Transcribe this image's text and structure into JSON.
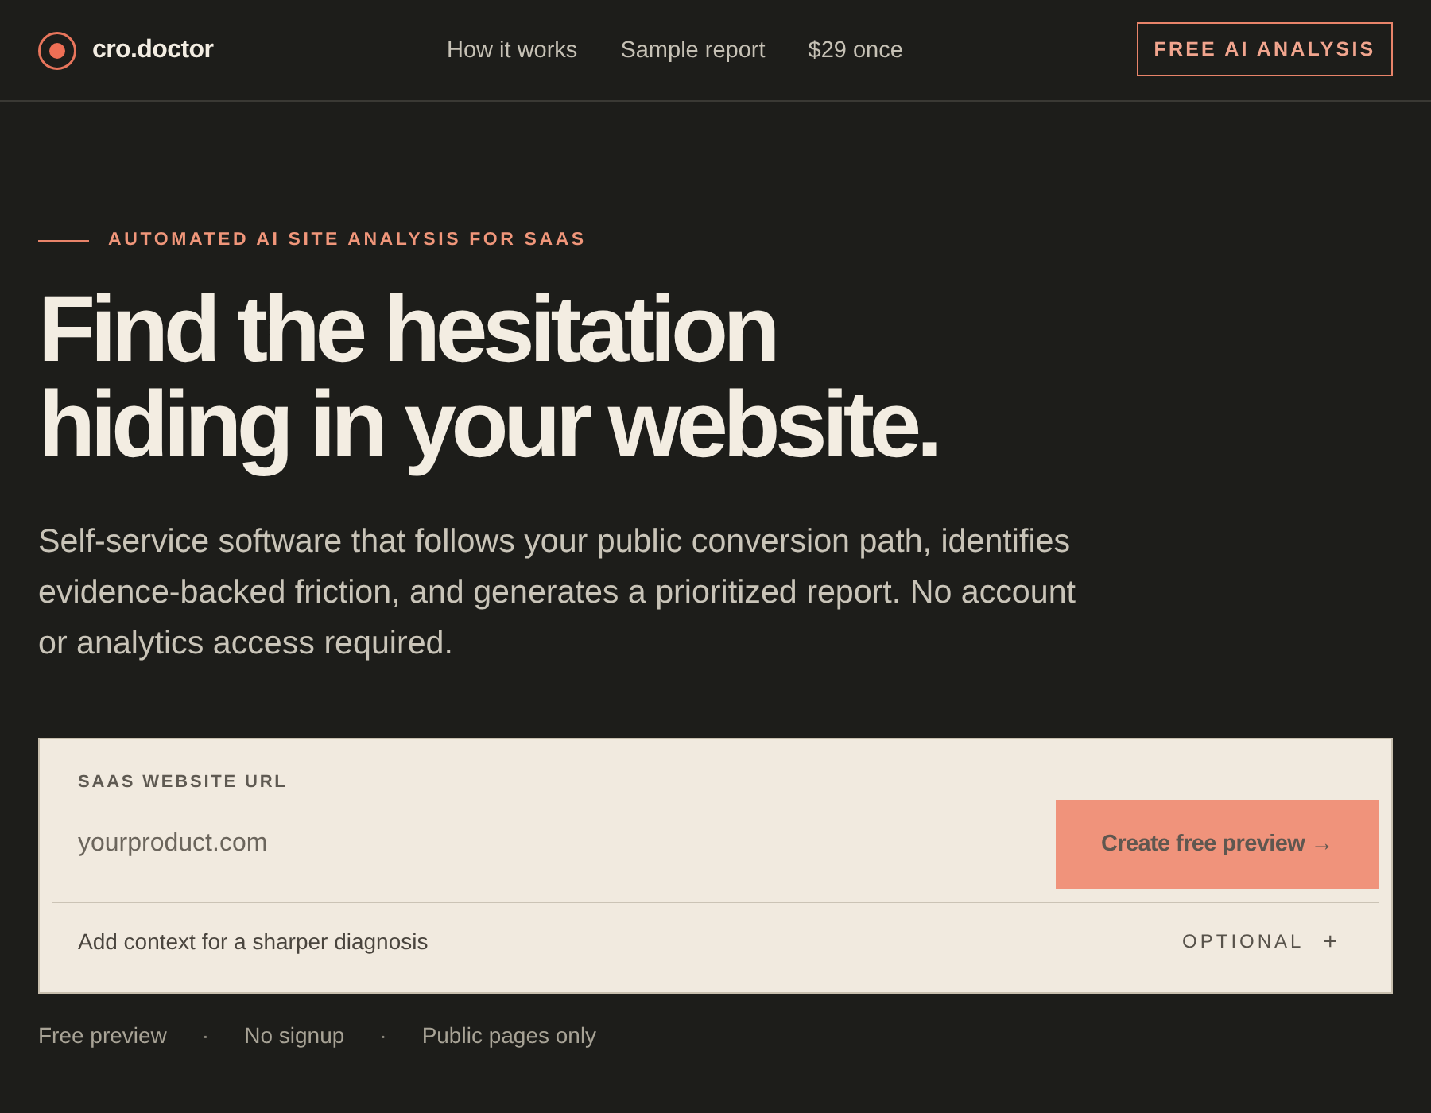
{
  "header": {
    "logo_text": "cro.doctor",
    "nav_links": [
      "How it works",
      "Sample report",
      "$29 once"
    ],
    "cta": "FREE AI ANALYSIS"
  },
  "hero": {
    "eyebrow": "AUTOMATED AI SITE ANALYSIS FOR SAAS",
    "headline": "Find the hesitation hiding in your website.",
    "description": "Self-service software that follows your public conversion path, identifies evidence-backed friction, and generates a prioritized report. No account or analytics access required."
  },
  "form": {
    "label": "SAAS WEBSITE URL",
    "placeholder": "yourproduct.com",
    "submit": "Create free preview →",
    "context": {
      "label": "Add context for a sharper diagnosis",
      "tag": "OPTIONAL",
      "toggle": "+"
    }
  },
  "trust_points": [
    {
      "text": "Free preview"
    },
    {
      "separator": "·",
      "text": "No signup"
    },
    {
      "separator": "·",
      "text": "Public pages only"
    }
  ]
}
